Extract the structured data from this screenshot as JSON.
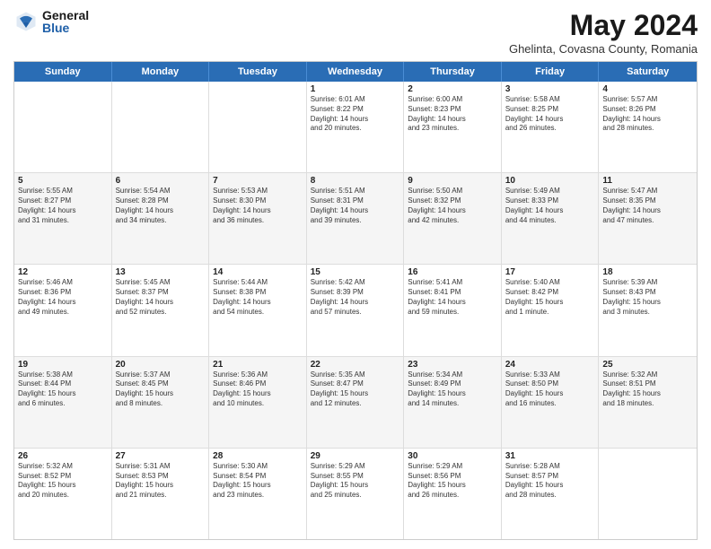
{
  "logo": {
    "general": "General",
    "blue": "Blue"
  },
  "title": "May 2024",
  "location": "Ghelinta, Covasna County, Romania",
  "weekdays": [
    "Sunday",
    "Monday",
    "Tuesday",
    "Wednesday",
    "Thursday",
    "Friday",
    "Saturday"
  ],
  "weeks": [
    [
      {
        "day": "",
        "text": ""
      },
      {
        "day": "",
        "text": ""
      },
      {
        "day": "",
        "text": ""
      },
      {
        "day": "1",
        "text": "Sunrise: 6:01 AM\nSunset: 8:22 PM\nDaylight: 14 hours\nand 20 minutes."
      },
      {
        "day": "2",
        "text": "Sunrise: 6:00 AM\nSunset: 8:23 PM\nDaylight: 14 hours\nand 23 minutes."
      },
      {
        "day": "3",
        "text": "Sunrise: 5:58 AM\nSunset: 8:25 PM\nDaylight: 14 hours\nand 26 minutes."
      },
      {
        "day": "4",
        "text": "Sunrise: 5:57 AM\nSunset: 8:26 PM\nDaylight: 14 hours\nand 28 minutes."
      }
    ],
    [
      {
        "day": "5",
        "text": "Sunrise: 5:55 AM\nSunset: 8:27 PM\nDaylight: 14 hours\nand 31 minutes."
      },
      {
        "day": "6",
        "text": "Sunrise: 5:54 AM\nSunset: 8:28 PM\nDaylight: 14 hours\nand 34 minutes."
      },
      {
        "day": "7",
        "text": "Sunrise: 5:53 AM\nSunset: 8:30 PM\nDaylight: 14 hours\nand 36 minutes."
      },
      {
        "day": "8",
        "text": "Sunrise: 5:51 AM\nSunset: 8:31 PM\nDaylight: 14 hours\nand 39 minutes."
      },
      {
        "day": "9",
        "text": "Sunrise: 5:50 AM\nSunset: 8:32 PM\nDaylight: 14 hours\nand 42 minutes."
      },
      {
        "day": "10",
        "text": "Sunrise: 5:49 AM\nSunset: 8:33 PM\nDaylight: 14 hours\nand 44 minutes."
      },
      {
        "day": "11",
        "text": "Sunrise: 5:47 AM\nSunset: 8:35 PM\nDaylight: 14 hours\nand 47 minutes."
      }
    ],
    [
      {
        "day": "12",
        "text": "Sunrise: 5:46 AM\nSunset: 8:36 PM\nDaylight: 14 hours\nand 49 minutes."
      },
      {
        "day": "13",
        "text": "Sunrise: 5:45 AM\nSunset: 8:37 PM\nDaylight: 14 hours\nand 52 minutes."
      },
      {
        "day": "14",
        "text": "Sunrise: 5:44 AM\nSunset: 8:38 PM\nDaylight: 14 hours\nand 54 minutes."
      },
      {
        "day": "15",
        "text": "Sunrise: 5:42 AM\nSunset: 8:39 PM\nDaylight: 14 hours\nand 57 minutes."
      },
      {
        "day": "16",
        "text": "Sunrise: 5:41 AM\nSunset: 8:41 PM\nDaylight: 14 hours\nand 59 minutes."
      },
      {
        "day": "17",
        "text": "Sunrise: 5:40 AM\nSunset: 8:42 PM\nDaylight: 15 hours\nand 1 minute."
      },
      {
        "day": "18",
        "text": "Sunrise: 5:39 AM\nSunset: 8:43 PM\nDaylight: 15 hours\nand 3 minutes."
      }
    ],
    [
      {
        "day": "19",
        "text": "Sunrise: 5:38 AM\nSunset: 8:44 PM\nDaylight: 15 hours\nand 6 minutes."
      },
      {
        "day": "20",
        "text": "Sunrise: 5:37 AM\nSunset: 8:45 PM\nDaylight: 15 hours\nand 8 minutes."
      },
      {
        "day": "21",
        "text": "Sunrise: 5:36 AM\nSunset: 8:46 PM\nDaylight: 15 hours\nand 10 minutes."
      },
      {
        "day": "22",
        "text": "Sunrise: 5:35 AM\nSunset: 8:47 PM\nDaylight: 15 hours\nand 12 minutes."
      },
      {
        "day": "23",
        "text": "Sunrise: 5:34 AM\nSunset: 8:49 PM\nDaylight: 15 hours\nand 14 minutes."
      },
      {
        "day": "24",
        "text": "Sunrise: 5:33 AM\nSunset: 8:50 PM\nDaylight: 15 hours\nand 16 minutes."
      },
      {
        "day": "25",
        "text": "Sunrise: 5:32 AM\nSunset: 8:51 PM\nDaylight: 15 hours\nand 18 minutes."
      }
    ],
    [
      {
        "day": "26",
        "text": "Sunrise: 5:32 AM\nSunset: 8:52 PM\nDaylight: 15 hours\nand 20 minutes."
      },
      {
        "day": "27",
        "text": "Sunrise: 5:31 AM\nSunset: 8:53 PM\nDaylight: 15 hours\nand 21 minutes."
      },
      {
        "day": "28",
        "text": "Sunrise: 5:30 AM\nSunset: 8:54 PM\nDaylight: 15 hours\nand 23 minutes."
      },
      {
        "day": "29",
        "text": "Sunrise: 5:29 AM\nSunset: 8:55 PM\nDaylight: 15 hours\nand 25 minutes."
      },
      {
        "day": "30",
        "text": "Sunrise: 5:29 AM\nSunset: 8:56 PM\nDaylight: 15 hours\nand 26 minutes."
      },
      {
        "day": "31",
        "text": "Sunrise: 5:28 AM\nSunset: 8:57 PM\nDaylight: 15 hours\nand 28 minutes."
      },
      {
        "day": "",
        "text": ""
      }
    ]
  ]
}
